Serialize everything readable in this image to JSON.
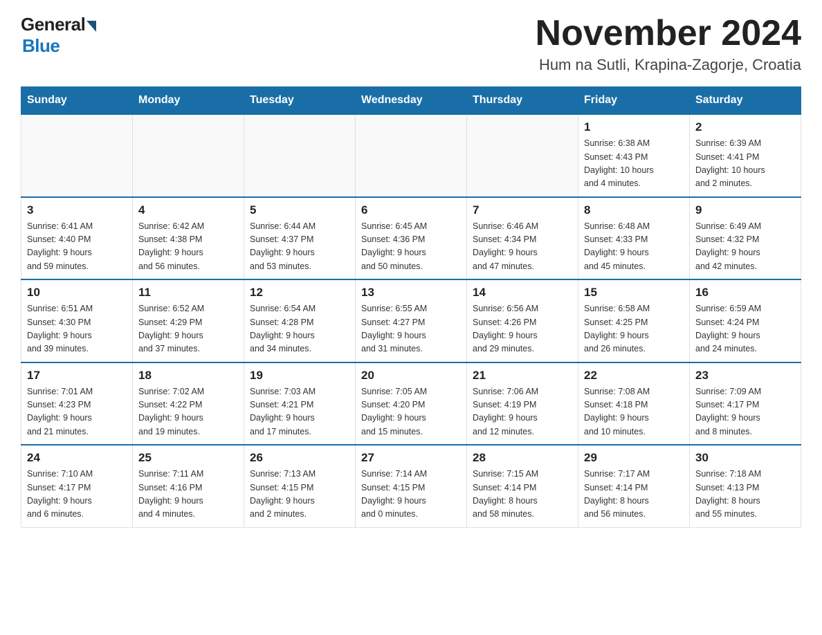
{
  "header": {
    "logo_general": "General",
    "logo_blue": "Blue",
    "month_title": "November 2024",
    "location": "Hum na Sutli, Krapina-Zagorje, Croatia"
  },
  "days_of_week": [
    "Sunday",
    "Monday",
    "Tuesday",
    "Wednesday",
    "Thursday",
    "Friday",
    "Saturday"
  ],
  "weeks": [
    [
      {
        "day": "",
        "info": ""
      },
      {
        "day": "",
        "info": ""
      },
      {
        "day": "",
        "info": ""
      },
      {
        "day": "",
        "info": ""
      },
      {
        "day": "",
        "info": ""
      },
      {
        "day": "1",
        "info": "Sunrise: 6:38 AM\nSunset: 4:43 PM\nDaylight: 10 hours\nand 4 minutes."
      },
      {
        "day": "2",
        "info": "Sunrise: 6:39 AM\nSunset: 4:41 PM\nDaylight: 10 hours\nand 2 minutes."
      }
    ],
    [
      {
        "day": "3",
        "info": "Sunrise: 6:41 AM\nSunset: 4:40 PM\nDaylight: 9 hours\nand 59 minutes."
      },
      {
        "day": "4",
        "info": "Sunrise: 6:42 AM\nSunset: 4:38 PM\nDaylight: 9 hours\nand 56 minutes."
      },
      {
        "day": "5",
        "info": "Sunrise: 6:44 AM\nSunset: 4:37 PM\nDaylight: 9 hours\nand 53 minutes."
      },
      {
        "day": "6",
        "info": "Sunrise: 6:45 AM\nSunset: 4:36 PM\nDaylight: 9 hours\nand 50 minutes."
      },
      {
        "day": "7",
        "info": "Sunrise: 6:46 AM\nSunset: 4:34 PM\nDaylight: 9 hours\nand 47 minutes."
      },
      {
        "day": "8",
        "info": "Sunrise: 6:48 AM\nSunset: 4:33 PM\nDaylight: 9 hours\nand 45 minutes."
      },
      {
        "day": "9",
        "info": "Sunrise: 6:49 AM\nSunset: 4:32 PM\nDaylight: 9 hours\nand 42 minutes."
      }
    ],
    [
      {
        "day": "10",
        "info": "Sunrise: 6:51 AM\nSunset: 4:30 PM\nDaylight: 9 hours\nand 39 minutes."
      },
      {
        "day": "11",
        "info": "Sunrise: 6:52 AM\nSunset: 4:29 PM\nDaylight: 9 hours\nand 37 minutes."
      },
      {
        "day": "12",
        "info": "Sunrise: 6:54 AM\nSunset: 4:28 PM\nDaylight: 9 hours\nand 34 minutes."
      },
      {
        "day": "13",
        "info": "Sunrise: 6:55 AM\nSunset: 4:27 PM\nDaylight: 9 hours\nand 31 minutes."
      },
      {
        "day": "14",
        "info": "Sunrise: 6:56 AM\nSunset: 4:26 PM\nDaylight: 9 hours\nand 29 minutes."
      },
      {
        "day": "15",
        "info": "Sunrise: 6:58 AM\nSunset: 4:25 PM\nDaylight: 9 hours\nand 26 minutes."
      },
      {
        "day": "16",
        "info": "Sunrise: 6:59 AM\nSunset: 4:24 PM\nDaylight: 9 hours\nand 24 minutes."
      }
    ],
    [
      {
        "day": "17",
        "info": "Sunrise: 7:01 AM\nSunset: 4:23 PM\nDaylight: 9 hours\nand 21 minutes."
      },
      {
        "day": "18",
        "info": "Sunrise: 7:02 AM\nSunset: 4:22 PM\nDaylight: 9 hours\nand 19 minutes."
      },
      {
        "day": "19",
        "info": "Sunrise: 7:03 AM\nSunset: 4:21 PM\nDaylight: 9 hours\nand 17 minutes."
      },
      {
        "day": "20",
        "info": "Sunrise: 7:05 AM\nSunset: 4:20 PM\nDaylight: 9 hours\nand 15 minutes."
      },
      {
        "day": "21",
        "info": "Sunrise: 7:06 AM\nSunset: 4:19 PM\nDaylight: 9 hours\nand 12 minutes."
      },
      {
        "day": "22",
        "info": "Sunrise: 7:08 AM\nSunset: 4:18 PM\nDaylight: 9 hours\nand 10 minutes."
      },
      {
        "day": "23",
        "info": "Sunrise: 7:09 AM\nSunset: 4:17 PM\nDaylight: 9 hours\nand 8 minutes."
      }
    ],
    [
      {
        "day": "24",
        "info": "Sunrise: 7:10 AM\nSunset: 4:17 PM\nDaylight: 9 hours\nand 6 minutes."
      },
      {
        "day": "25",
        "info": "Sunrise: 7:11 AM\nSunset: 4:16 PM\nDaylight: 9 hours\nand 4 minutes."
      },
      {
        "day": "26",
        "info": "Sunrise: 7:13 AM\nSunset: 4:15 PM\nDaylight: 9 hours\nand 2 minutes."
      },
      {
        "day": "27",
        "info": "Sunrise: 7:14 AM\nSunset: 4:15 PM\nDaylight: 9 hours\nand 0 minutes."
      },
      {
        "day": "28",
        "info": "Sunrise: 7:15 AM\nSunset: 4:14 PM\nDaylight: 8 hours\nand 58 minutes."
      },
      {
        "day": "29",
        "info": "Sunrise: 7:17 AM\nSunset: 4:14 PM\nDaylight: 8 hours\nand 56 minutes."
      },
      {
        "day": "30",
        "info": "Sunrise: 7:18 AM\nSunset: 4:13 PM\nDaylight: 8 hours\nand 55 minutes."
      }
    ]
  ]
}
